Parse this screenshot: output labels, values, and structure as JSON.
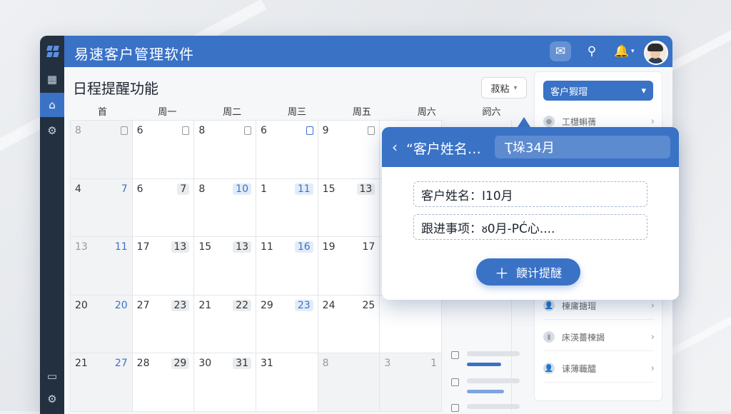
{
  "app": {
    "title": "易速客户管理软件"
  },
  "titlebar": {
    "icons": [
      "message-alert-icon",
      "search-icon",
      "bell-icon",
      "chevron-down-icon",
      "user-avatar"
    ]
  },
  "sidebar": {
    "icons": [
      "layout-icon",
      "home-icon",
      "gear-icon",
      "chat-icon",
      "settings-icon"
    ]
  },
  "page": {
    "title": "日程提醒功能"
  },
  "view_select": {
    "label": "菽粘"
  },
  "calendar": {
    "weekdays": [
      "首",
      "周一",
      "周二",
      "周三",
      "周五",
      "周六",
      "阏六"
    ],
    "rows": [
      [
        [
          "8",
          ""
        ],
        [
          "6",
          ""
        ],
        [
          "8",
          ""
        ],
        [
          "6",
          ""
        ],
        [
          "9",
          ""
        ],
        [
          "",
          ""
        ]
      ],
      [
        [
          "4",
          "7"
        ],
        [
          "6",
          "7"
        ],
        [
          "8",
          "10"
        ],
        [
          "1",
          "11"
        ],
        [
          "15",
          "13"
        ],
        [
          "",
          ""
        ]
      ],
      [
        [
          "13",
          "11"
        ],
        [
          "17",
          "13"
        ],
        [
          "15",
          "13"
        ],
        [
          "11",
          "16"
        ],
        [
          "19",
          "17"
        ],
        [
          "",
          ""
        ]
      ],
      [
        [
          "20",
          "20"
        ],
        [
          "27",
          "23"
        ],
        [
          "21",
          "22"
        ],
        [
          "29",
          "23"
        ],
        [
          "24",
          "25"
        ],
        [
          "",
          ""
        ]
      ],
      [
        [
          "21",
          "27"
        ],
        [
          "28",
          "29"
        ],
        [
          "30",
          "31"
        ],
        [
          "31",
          ""
        ],
        [
          "8",
          ""
        ],
        [
          "3",
          "1"
        ]
      ]
    ]
  },
  "right_panel": {
    "dropdown": "客户猳瑁",
    "items": [
      "工櫘蝌蒨",
      "",
      "",
      "",
      "",
      "",
      "楝庯搪瑁",
      "床渶薔楝謁",
      "诔薄蘵醽"
    ]
  },
  "popup": {
    "title": "“客户姓名…",
    "tag": "Ҭ垛34月",
    "field_name": "客户姓名：I10月",
    "field_followup": "跟进事项：ᴕ0月-РĆ心....",
    "button": "餪计提醚"
  },
  "colors": {
    "accent": "#3a72c6",
    "sidebar": "#23303f",
    "progress_blue": "#3a72c6",
    "progress_green": "#3fae6a"
  }
}
